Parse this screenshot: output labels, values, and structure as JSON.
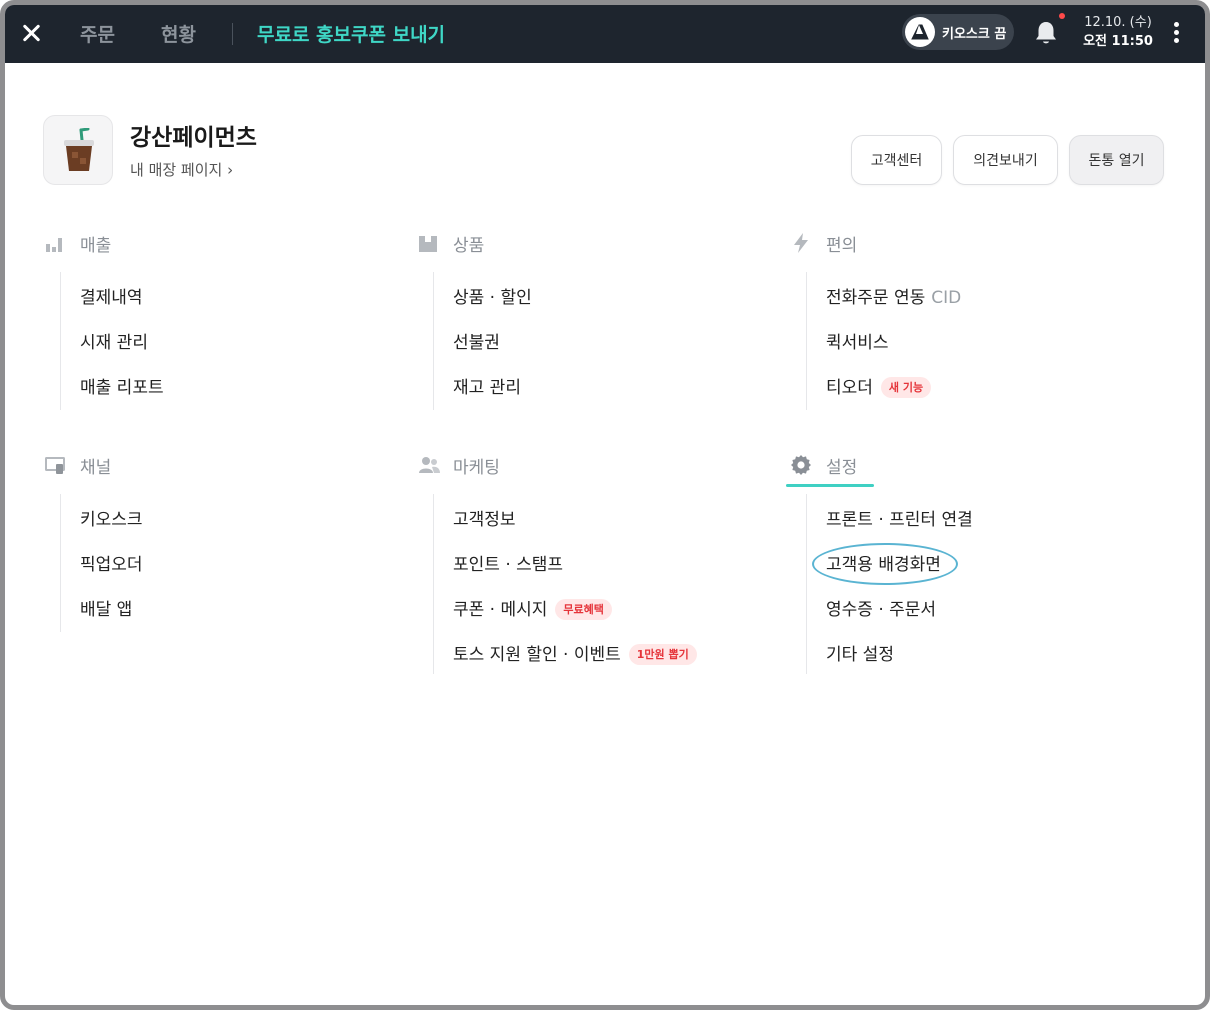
{
  "topbar": {
    "tabs": [
      {
        "label": "주문"
      },
      {
        "label": "현황"
      }
    ],
    "promo_label": "무료로 홍보쿠폰 보내기",
    "kiosk_toggle": "키오스크 끔",
    "date": "12.10. (수)",
    "time": "오전 11:50"
  },
  "store": {
    "name": "강산페이먼츠",
    "my_store_link": "내 매장 페이지 ›"
  },
  "header_buttons": {
    "customer_center": "고객센터",
    "feedback": "의견보내기",
    "open_drawer": "돈통 열기"
  },
  "sections": {
    "sales": {
      "title": "매출",
      "items": [
        "결제내역",
        "시재 관리",
        "매출 리포트"
      ]
    },
    "products": {
      "title": "상품",
      "items": [
        "상품 · 할인",
        "선불권",
        "재고 관리"
      ]
    },
    "convenience": {
      "title": "편의",
      "items": [
        "전화주문 연동",
        "퀵서비스",
        "티오더"
      ],
      "cid_suffix": "CID",
      "new_badge": "새 기능"
    },
    "channel": {
      "title": "채널",
      "items": [
        "키오스크",
        "픽업오더",
        "배달 앱"
      ]
    },
    "marketing": {
      "title": "마케팅",
      "items": [
        "고객정보",
        "포인트 · 스탬프",
        "쿠폰 · 메시지",
        "토스 지원 할인 · 이벤트"
      ],
      "coupon_badge": "무료혜택",
      "event_badge": "1만원 뽑기"
    },
    "settings": {
      "title": "설정",
      "items": [
        "프론트 · 프린터 연결",
        "고객용 배경화면",
        "영수증 · 주문서",
        "기타 설정"
      ]
    }
  },
  "colors": {
    "topbar_bg": "#1e252e",
    "accent_teal": "#3fd7c6",
    "badge_red": "#e5343a",
    "highlight_circle": "#5ab4d2"
  },
  "icons": {
    "close": "close-icon",
    "bell": "bell-icon",
    "more": "more-vertical-icon",
    "sales": "bar-chart-icon",
    "products": "box-icon",
    "convenience": "lightning-icon",
    "channel": "monitor-icon",
    "marketing": "people-icon",
    "settings": "gear-icon"
  }
}
